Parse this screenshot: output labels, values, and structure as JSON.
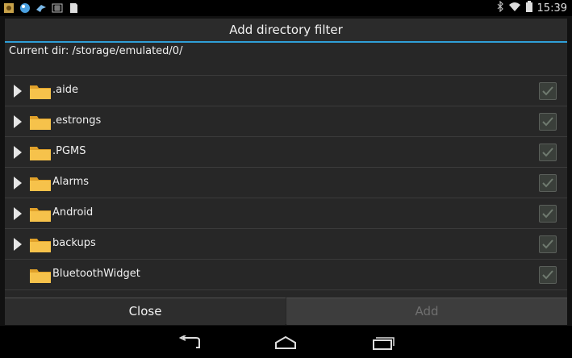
{
  "status_bar": {
    "time": "15:39",
    "notification_icons": [
      "app-icon",
      "globe-icon",
      "bird-icon",
      "keyboard-icon",
      "sd-card-icon"
    ],
    "system_icons": [
      "bluetooth-icon",
      "wifi-icon",
      "battery-icon"
    ]
  },
  "dialog": {
    "title": "Add directory filter",
    "current_dir": "Current dir: /storage/emulated/0/",
    "accent_color": "#2f9fd8",
    "items": [
      {
        "label": ".aide",
        "expandable": true
      },
      {
        "label": ".estrongs",
        "expandable": true
      },
      {
        "label": ".PGMS",
        "expandable": true
      },
      {
        "label": "Alarms",
        "expandable": true
      },
      {
        "label": "Android",
        "expandable": true
      },
      {
        "label": "backups",
        "expandable": true
      },
      {
        "label": "BluetoothWidget",
        "expandable": false
      }
    ],
    "close_label": "Close",
    "add_label": "Add"
  },
  "nav_bar": {
    "buttons": [
      "back-icon",
      "home-icon",
      "recent-apps-icon"
    ]
  }
}
